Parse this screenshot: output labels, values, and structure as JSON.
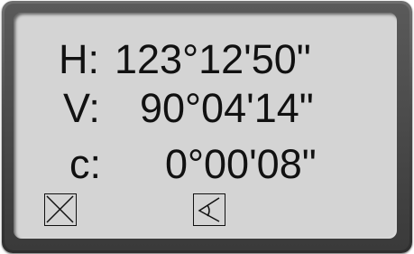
{
  "display": {
    "rows": [
      {
        "label": "H:",
        "value": "123°12'50\""
      },
      {
        "label": "V:",
        "value": "90°04'14\""
      },
      {
        "label": "c:",
        "value": "0°00'08\""
      }
    ],
    "softkeys": [
      {
        "icon": "close-box-icon"
      },
      {
        "icon": "prism-target-icon"
      }
    ]
  },
  "colors": {
    "screen": "#d4d4d4",
    "bezel": "#4a4a4a",
    "text": "#111111"
  }
}
